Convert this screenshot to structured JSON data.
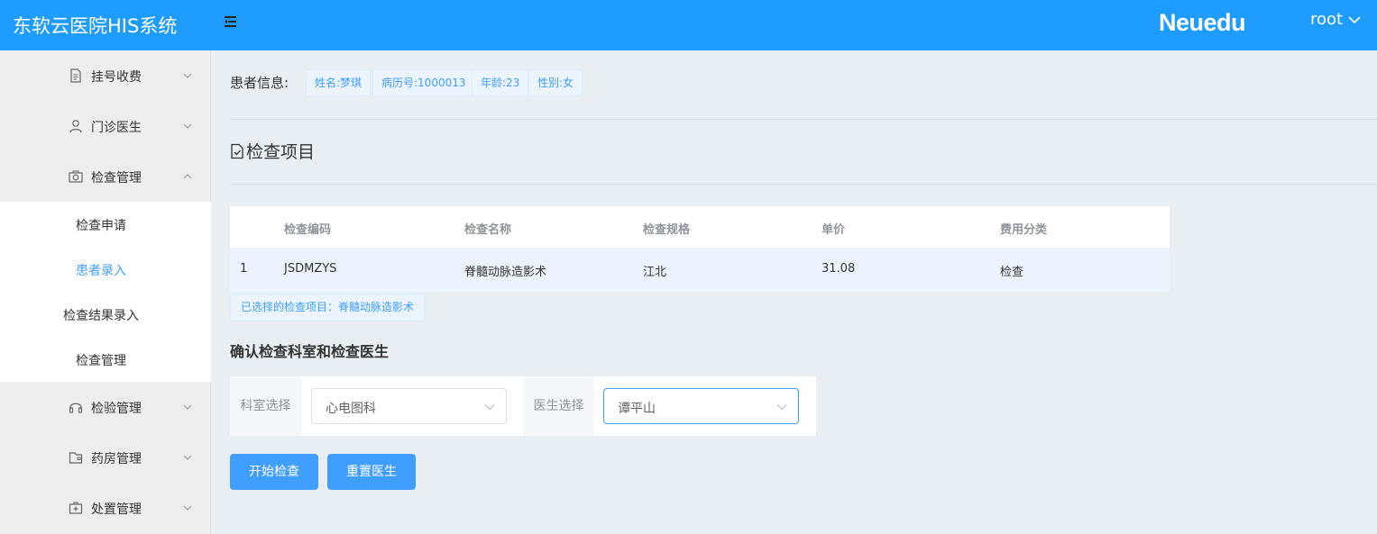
{
  "header": {
    "app_title": "东软云医院HIS系统",
    "brand": "Neuedu",
    "user": "root"
  },
  "sidebar": {
    "items": [
      {
        "label": "挂号收费",
        "icon": "document-icon",
        "expanded": false
      },
      {
        "label": "门诊医生",
        "icon": "user-icon",
        "expanded": false
      },
      {
        "label": "检查管理",
        "icon": "camera-icon",
        "expanded": true
      },
      {
        "label": "检验管理",
        "icon": "headset-icon",
        "expanded": false
      },
      {
        "label": "药房管理",
        "icon": "wallet-icon",
        "expanded": false
      },
      {
        "label": "处置管理",
        "icon": "first-aid-icon",
        "expanded": false
      }
    ],
    "submenu": [
      {
        "label": "检查申请"
      },
      {
        "label": "患者录入",
        "active": true
      },
      {
        "label": "检查结果录入"
      },
      {
        "label": "检查管理"
      }
    ]
  },
  "patient": {
    "label": "患者信息:",
    "tags": [
      "姓名:梦琪",
      "病历号:1000013",
      "年龄:23",
      "性别:女"
    ]
  },
  "section_title": "检查项目",
  "table": {
    "headers": [
      "检查编码",
      "检查名称",
      "检查规格",
      "单价",
      "费用分类"
    ],
    "rows": [
      {
        "index": "1",
        "code": "JSDMZYS",
        "name": "脊髓动脉造影术",
        "spec": "江北",
        "price": "31.08",
        "category": "检查"
      }
    ]
  },
  "selected_item": "已选择的检查项目：脊髓动脉造影术",
  "confirm_title": "确认检查科室和检查医生",
  "form": {
    "dept_label": "科室选择",
    "dept_value": "心电图科",
    "doctor_label": "医生选择",
    "doctor_value": "谭平山"
  },
  "buttons": {
    "start": "开始检查",
    "reset": "重置医生"
  },
  "colors": {
    "header": "#1f9cff",
    "primary": "#409eff",
    "tag_bg": "#ecf5ff",
    "sidebar_bg": "#eeeeee",
    "page_bg": "#e9eef3"
  }
}
